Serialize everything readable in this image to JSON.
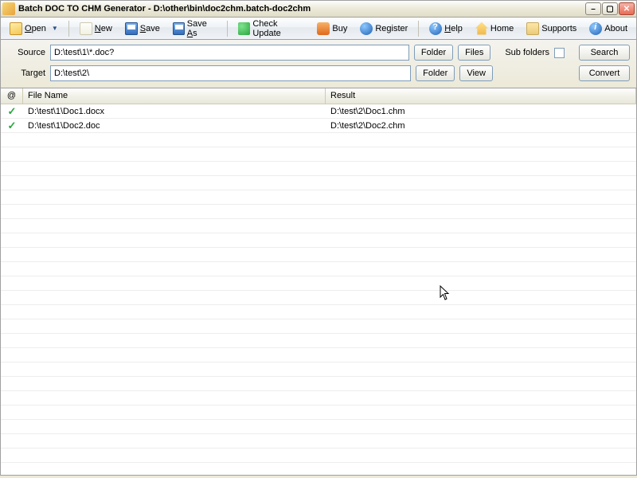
{
  "window": {
    "title": "Batch DOC TO CHM Generator - D:\\other\\bin\\doc2chm.batch-doc2chm"
  },
  "toolbar": {
    "open": "Open",
    "new": "New",
    "save": "Save",
    "save_as": "Save As",
    "check_update": "Check Update",
    "buy": "Buy",
    "register": "Register",
    "help": "Help",
    "home": "Home",
    "supports": "Supports",
    "about": "About"
  },
  "form": {
    "source_label": "Source",
    "source_value": "D:\\test\\1\\*.doc?",
    "target_label": "Target",
    "target_value": "D:\\test\\2\\",
    "folder_btn": "Folder",
    "files_btn": "Files",
    "view_btn": "View",
    "subfolders_label": "Sub folders",
    "search_btn": "Search",
    "convert_btn": "Convert"
  },
  "grid": {
    "col_status": "@",
    "col_file": "File Name",
    "col_result": "Result",
    "rows": [
      {
        "status": "ok",
        "file": "D:\\test\\1\\Doc1.docx",
        "result": "D:\\test\\2\\Doc1.chm"
      },
      {
        "status": "ok",
        "file": "D:\\test\\1\\Doc2.doc",
        "result": "D:\\test\\2\\Doc2.chm"
      }
    ]
  }
}
